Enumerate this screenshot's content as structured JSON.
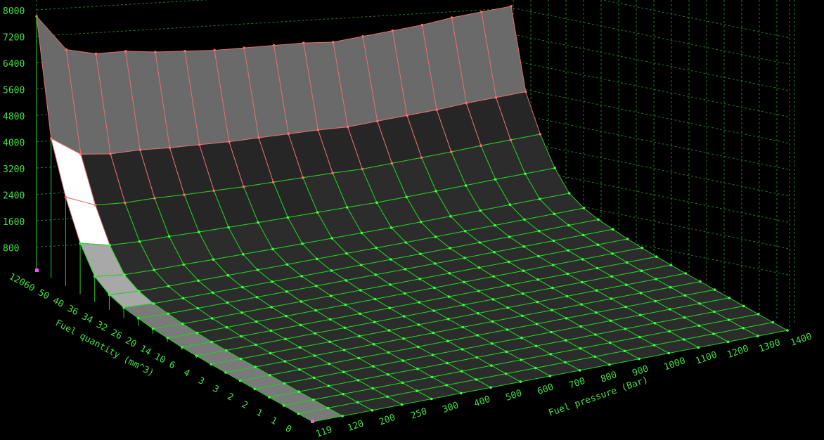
{
  "chart_data": {
    "type": "surface3d",
    "title": "",
    "z_axis": {
      "label": "",
      "ticks": [
        "8000",
        "7200",
        "6400",
        "5600",
        "4800",
        "4000",
        "3200",
        "2400",
        "1600",
        "800"
      ],
      "range": [
        0,
        8000
      ]
    },
    "quantity_axis": {
      "label": "Fuel quantity (mm^3)",
      "ticks": [
        "120",
        "60",
        "50",
        "40",
        "36",
        "34",
        "32",
        "26",
        "20",
        "14",
        "10",
        "6",
        "4",
        "3",
        "3",
        "2",
        "2",
        "1",
        "1",
        "0"
      ]
    },
    "pressure_axis": {
      "label": "Fuel pressure (Bar)",
      "ticks": [
        "119",
        "120",
        "200",
        "250",
        "300",
        "400",
        "500",
        "600",
        "700",
        "800",
        "900",
        "1000",
        "1100",
        "1200",
        "1300",
        "1400"
      ]
    },
    "colors": {
      "background": "#000000",
      "grid": "#1f7a1f",
      "axis_text": "#3fe03f",
      "mesh_green": "#20d020",
      "mesh_red": "#e07070",
      "node_green": "#40ff40",
      "node_red": "#ff6a6a"
    },
    "back_ridge_values": [
      7800,
      6600,
      6300,
      6200,
      6000,
      5850,
      5700,
      5600,
      5500,
      5400,
      5250,
      5250,
      5250,
      5250,
      5300,
      5300,
      5300
    ],
    "surface_falloff": [
      1.0,
      0.55,
      0.35,
      0.2,
      0.1,
      0.06,
      0.04,
      0.03,
      0.02,
      0.015,
      0.01,
      0.008,
      0.006,
      0.005,
      0.004,
      0.003,
      0.002,
      0.001,
      0.0,
      0.0
    ]
  }
}
